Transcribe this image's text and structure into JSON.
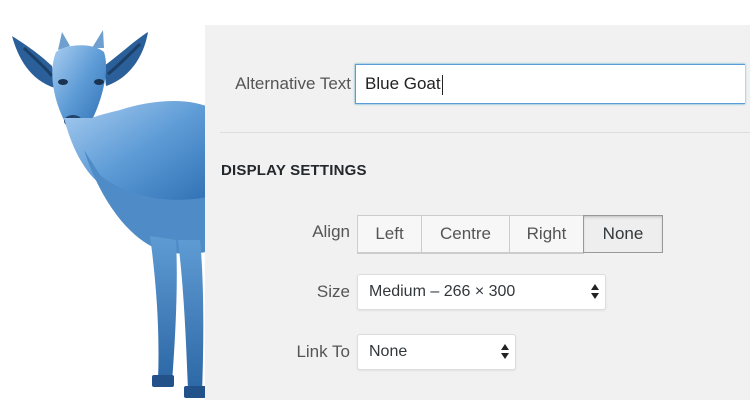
{
  "alt_text": {
    "label": "Alternative Text",
    "value": "Blue Goat"
  },
  "display_settings": {
    "title": "DISPLAY SETTINGS",
    "align": {
      "label": "Align",
      "options": [
        "Left",
        "Centre",
        "Right",
        "None"
      ],
      "selected": "None"
    },
    "size": {
      "label": "Size",
      "value": "Medium – 266 × 300"
    },
    "link_to": {
      "label": "Link To",
      "value": "None"
    }
  },
  "colors": {
    "goat": "#4f8fcf",
    "panel": "#f1f1f1",
    "focus_border": "#5b9dd9"
  },
  "icons": {
    "select_arrows": "updown-arrows-icon"
  }
}
